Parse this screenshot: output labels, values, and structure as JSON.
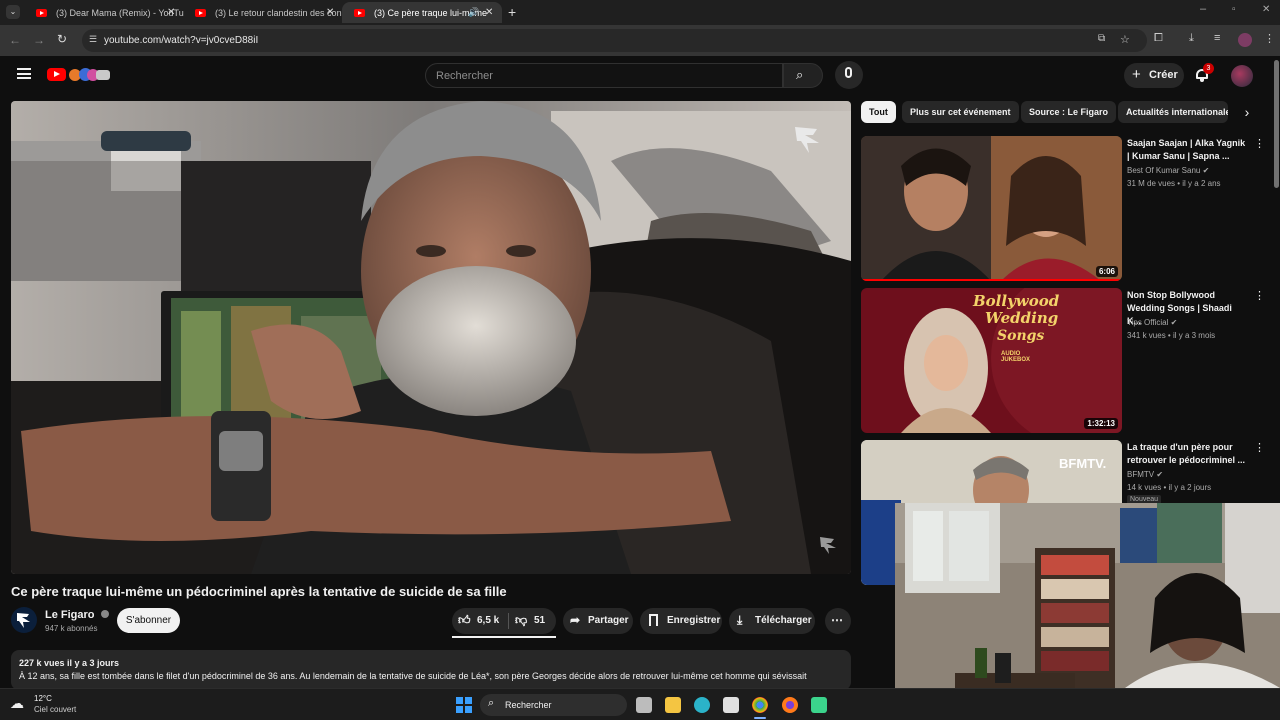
{
  "tabs": [
    {
      "title": "(3) Dear Mama (Remix) - YouTub"
    },
    {
      "title": "(3) Le retour clandestin des con"
    },
    {
      "title": "(3) Ce père traque lui-même"
    }
  ],
  "address": {
    "url": "youtube.com/watch?v=jv0cveD88iI"
  },
  "youtube": {
    "search_placeholder": "Rechercher",
    "create_label": "Créer",
    "notification_count": "3"
  },
  "video": {
    "title": "Ce père traque lui-même un pédocriminel après la tentative de suicide de sa fille",
    "channel_name": "Le Figaro",
    "subscribers": "947 k abonnés",
    "subscribe_label": "S'abonner",
    "likes": "6,5 k",
    "dislikes": "51",
    "share_label": "Partager",
    "save_label": "Enregistrer",
    "download_label": "Télécharger",
    "views_date": "227 k vues  il y a 3 jours",
    "description": "À 12 ans, sa fille est tombée dans le filet d'un pédocriminel de 36 ans. Au lendemain de la tentative de suicide de Léa*, son père Georges décide alors de retrouver lui-même cet homme qui sévissait"
  },
  "chips": [
    {
      "label": "Tout"
    },
    {
      "label": "Plus sur cet événement"
    },
    {
      "label": "Source : Le Figaro"
    },
    {
      "label": "Actualités internationale"
    }
  ],
  "recommendations": [
    {
      "title": "Saajan Saajan | Alka Yagnik | Kumar Sanu | Sapna ...",
      "channel": "Best Of Kumar Sanu",
      "meta": "31 M de vues • il y a 2 ans",
      "duration": "6:06",
      "badge": ""
    },
    {
      "title": "Non Stop Bollywood Wedding Songs | Shaadi K...",
      "channel": "Tips Official",
      "meta": "341 k vues • il y a 3 mois",
      "duration": "1:32:13",
      "badge": "",
      "thumb_text_1": "Bollywood",
      "thumb_text_2": "Wedding",
      "thumb_text_3": "Songs",
      "thumb_text_4": "AUDIO JUKEBOX"
    },
    {
      "title": "La traque d'un père pour retrouver le pédocriminel ...",
      "channel": "BFMTV",
      "meta": "14 k vues • il y a 2 jours",
      "duration": "",
      "badge": "Nouveau",
      "thumb_text_1": "BFMTV."
    }
  ],
  "taskbar": {
    "weather_temp": "12°C",
    "weather_desc": "Ciel couvert",
    "search_label": "Rechercher"
  },
  "colors": {
    "accent": "#ff0000",
    "bg": "#0f0f0f",
    "chip": "#272727"
  }
}
